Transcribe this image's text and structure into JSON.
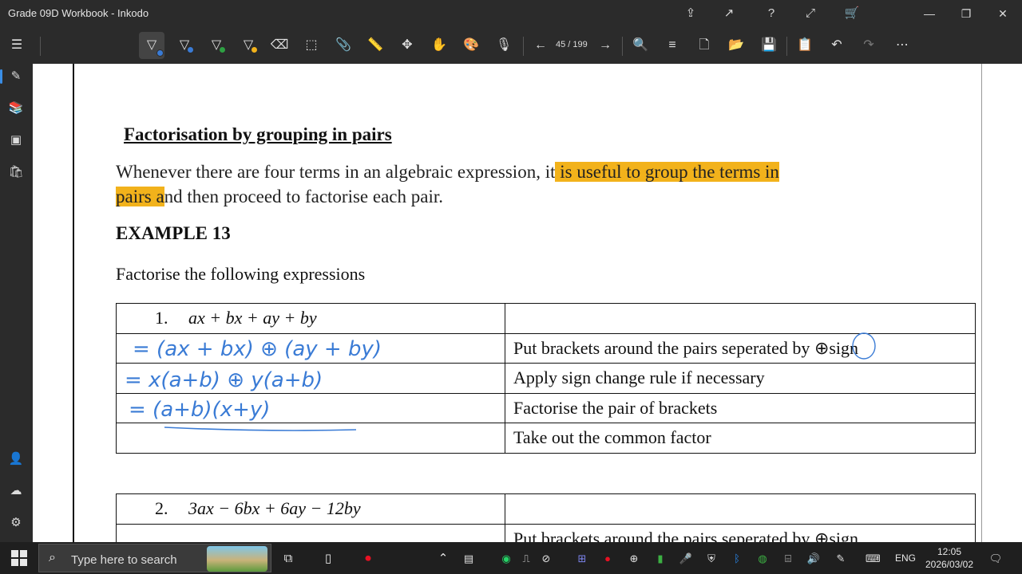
{
  "window": {
    "title": "Grade 09D Workbook - Inkodo",
    "controls": {
      "minimize": "—",
      "restore": "❐",
      "close": "✕"
    },
    "title_icons": [
      "share-icon",
      "export-icon",
      "help-icon",
      "fullscreen-icon",
      "cart-icon"
    ]
  },
  "toolbar": {
    "pen_colors": [
      "#3a7bd5",
      "#3a7bd5",
      "#2ea043",
      "#f2b21b"
    ],
    "page_indicator": "45 / 199",
    "tools": [
      "pen-1",
      "pen-2",
      "pen-3",
      "highlighter",
      "eraser",
      "lasso-select",
      "attach",
      "ruler",
      "move",
      "hand",
      "palette",
      "microphone",
      "prev-page",
      "next-page",
      "zoom",
      "settings",
      "new-page",
      "open",
      "save",
      "clipboard",
      "undo",
      "redo",
      "more"
    ]
  },
  "sidebar": {
    "items": [
      "ink-tool",
      "library",
      "media",
      "store",
      "person-search",
      "cloud",
      "settings"
    ]
  },
  "document": {
    "heading": "Factorisation by grouping in pairs",
    "paragraph_part1": "Whenever there are four terms in an algebraic expression, it",
    "paragraph_highlight1": " is useful to group the terms in",
    "paragraph_highlight2": "pairs a",
    "paragraph_part2": "nd then proceed to factorise each pair.",
    "example_title": "EXAMPLE 13",
    "instruction": "Factorise the following expressions",
    "table1": {
      "question_number": "1.",
      "question_expr": "ax + bx + ay + by",
      "steps": [
        "Put brackets around the pairs seperated by",
        "Apply sign change rule if necessary",
        "Factorise the pair of brackets",
        "Take out the common factor"
      ],
      "plus_symbol": "⊕",
      "step1_suffix": "sign"
    },
    "table2": {
      "question_number": "2.",
      "question_expr": "3ax − 6bx + 6ay − 12by",
      "step1": "Put brackets around the pairs seperated by",
      "plus_symbol": "⊕",
      "step1_suffix": "sign"
    },
    "handwriting": {
      "line1": "= (ax + bx) ⊕ (ay + by)",
      "line2": "= x(a+b) ⊕ y(a+b)",
      "line3": "= (a+b)(x+y)"
    },
    "ink_colors": {
      "blue": "#3a7bd5",
      "green": "#2ea043",
      "orange": "#f2b21b",
      "highlight": "#f2b21b"
    }
  },
  "taskbar": {
    "search_placeholder": "Type here to search",
    "language": "ENG",
    "time": "12:05",
    "date": "2026/03/02"
  }
}
